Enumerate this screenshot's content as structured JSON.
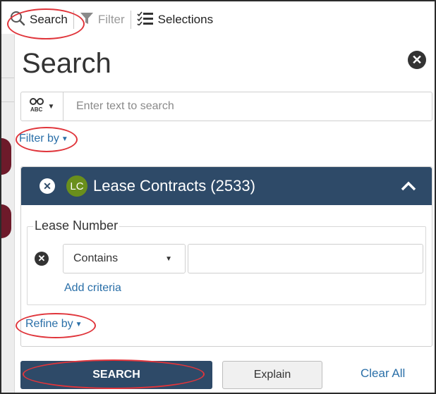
{
  "toolbar": {
    "search_label": "Search",
    "filter_label": "Filter",
    "selections_label": "Selections"
  },
  "panel": {
    "title": "Search",
    "search_placeholder": "Enter text to search",
    "filter_by_label": "Filter by",
    "refine_by_label": "Refine by"
  },
  "card": {
    "badge": "LC",
    "title": "Lease Contracts (2533)",
    "field_label": "Lease Number",
    "operator": "Contains",
    "value": "",
    "add_criteria_label": "Add criteria"
  },
  "buttons": {
    "search_label": "SEARCH",
    "explain_label": "Explain",
    "clear_all_label": "Clear All"
  },
  "colors": {
    "header_bg": "#2e4a68",
    "link": "#2a6fa8",
    "badge_bg": "#6a8f1c",
    "highlight": "#e0353b"
  }
}
